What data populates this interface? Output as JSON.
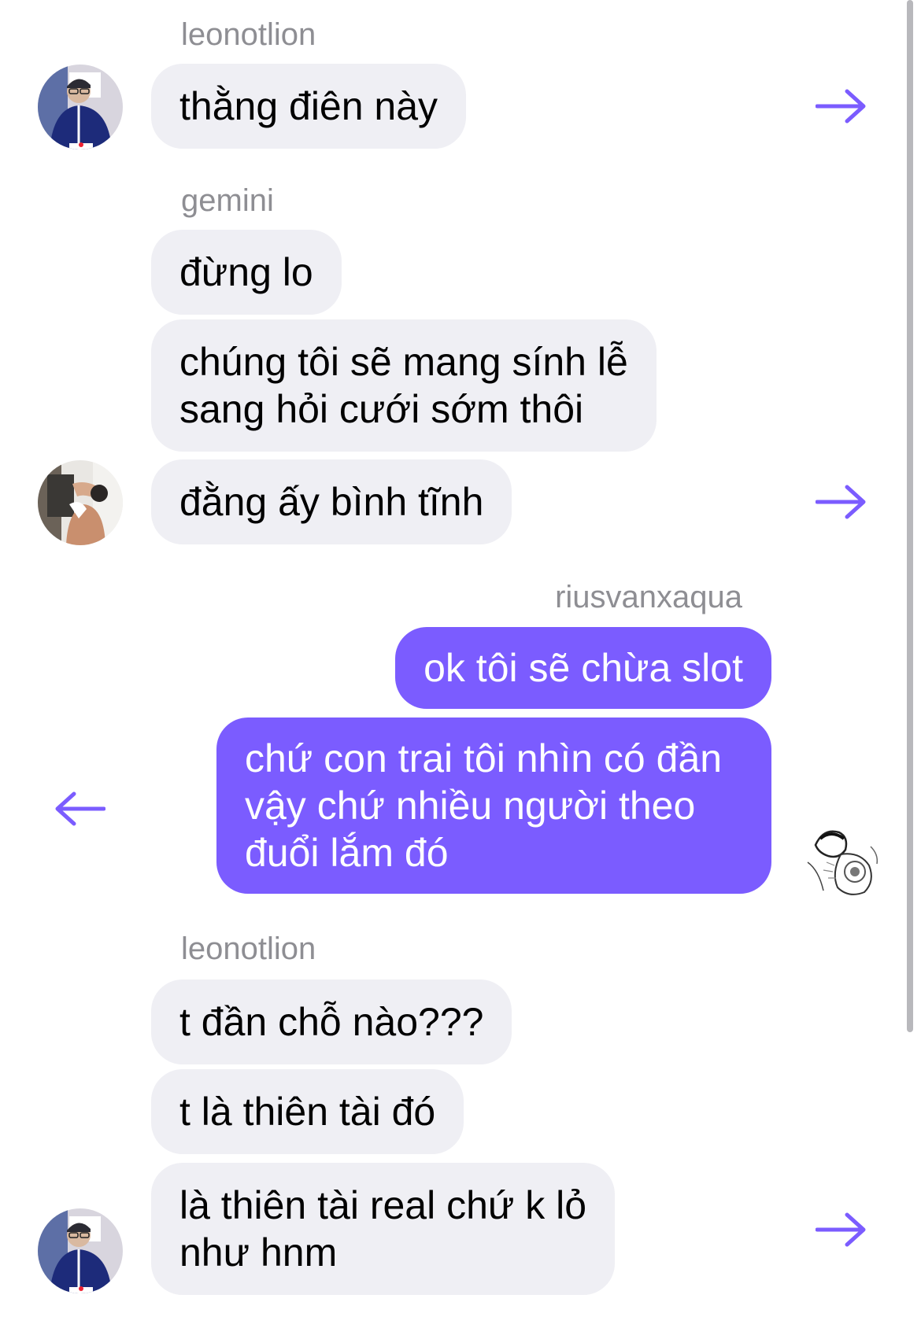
{
  "theme": {
    "accent": "#7b5cff",
    "incoming_bubble": "#efeff4",
    "sender_text": "#8e8e93"
  },
  "messages": [
    {
      "sender": "leonotlion",
      "text": "thằng điên này",
      "direction": "incoming",
      "forward_icon": "arrow-right-icon"
    },
    {
      "sender": "gemini",
      "text": "đừng lo",
      "direction": "incoming"
    },
    {
      "text": "chúng tôi sẽ mang sính lễ\nsang hỏi cưới sớm thôi",
      "direction": "incoming"
    },
    {
      "text": "đằng ấy bình tĩnh",
      "direction": "incoming",
      "forward_icon": "arrow-right-icon"
    },
    {
      "sender": "riusvanxaqua",
      "text": "ok tôi sẽ chừa slot",
      "direction": "outgoing"
    },
    {
      "text": "chứ con trai tôi nhìn có đần\nvậy chứ nhiều người theo\nđuổi lắm đó",
      "direction": "outgoing",
      "forward_icon": "arrow-left-icon"
    },
    {
      "sender": "leonotlion",
      "text": "t đần chỗ nào???",
      "direction": "incoming"
    },
    {
      "text": "t là thiên tài đó",
      "direction": "incoming"
    },
    {
      "text": "là thiên tài real chứ k lỏ\nnhư hnm",
      "direction": "incoming",
      "forward_icon": "arrow-right-icon"
    }
  ]
}
